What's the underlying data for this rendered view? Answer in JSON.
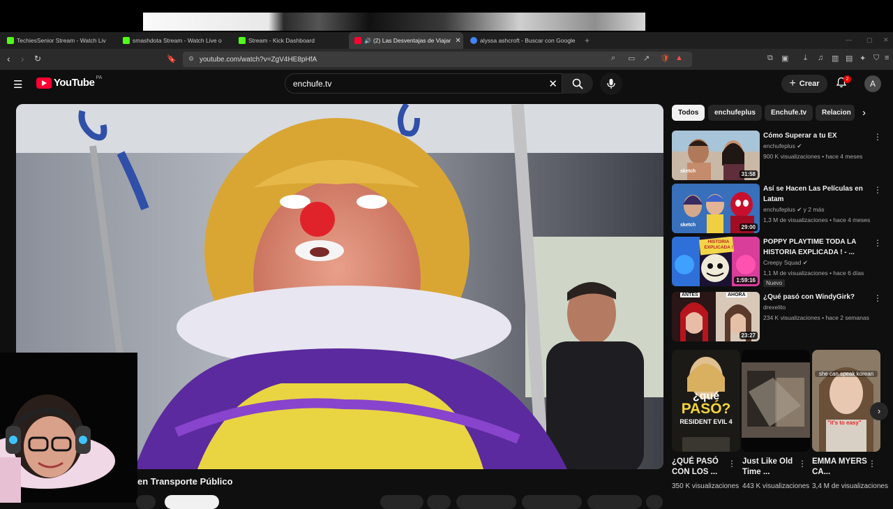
{
  "browser": {
    "tabs": [
      {
        "label": "TechiesSenior Stream - Watch Liv",
        "color": "#53fc18"
      },
      {
        "label": "smashdota Stream - Watch Live o",
        "color": "#53fc18"
      },
      {
        "label": "Stream - Kick Dashboard",
        "color": "#53fc18"
      },
      {
        "label": "(2) Las Desventajas de Viajar",
        "color": "#ff0033"
      },
      {
        "label": "alyssa ashcroft - Buscar con Google",
        "color": "#4285f4"
      }
    ],
    "url": "youtube.com/watch?v=ZgV4HE8pHfA"
  },
  "youtube": {
    "logo": "YouTube",
    "country": "PA",
    "search_value": "enchufe.tv",
    "create_label": "Crear",
    "notif_count": "2",
    "avatar_letter": "A"
  },
  "video": {
    "title": "en Transporte Público"
  },
  "chips": [
    "Todos",
    "enchufeplus",
    "Enchufe.tv",
    "Relacion"
  ],
  "recommendations": [
    {
      "title": "Cómo Superar a tu EX",
      "channel": "enchufeplus ✔",
      "meta": "900 K visualizaciones • hace 4 meses",
      "duration": "31:58",
      "tag": "sketch"
    },
    {
      "title": "Así se Hacen Las Películas en Latam",
      "channel": "enchufeplus ✔ y 2 más",
      "meta": "1,3 M de visualizaciones • hace 4 meses",
      "duration": "29:00",
      "tag": "sketch"
    },
    {
      "title": "POPPY PLAYTIME TODA LA HISTORIA EXPLICADA ! - ...",
      "channel": "Creepy Squad ✔",
      "meta": "1,1 M de visualizaciones • hace 6 días",
      "duration": "1:59:16",
      "badge": "Nuevo",
      "thumbtext": "HISTORIA EXPLICADA !"
    },
    {
      "title": "¿Qué pasó con WindyGirk?",
      "channel": "drexelito",
      "meta": "234 K visualizaciones • hace 2 semanas",
      "duration": "23:27",
      "before": "ANTES",
      "after": "AHORA"
    }
  ],
  "shorts": [
    {
      "title": "¿QUÉ PASÓ CON LOS ...",
      "views": "350 K visualizaciones",
      "art1": "¿qué",
      "art2": "PASÓ?",
      "art3": "RESIDENT EVIL 4"
    },
    {
      "title": "Just Like Old Time ...",
      "views": "443 K visualizaciones"
    },
    {
      "title": "EMMA MYERS CA...",
      "views": "3,4 M de visualizaciones",
      "art1": "she can speak korean",
      "art2": "\"it's to easy\""
    }
  ]
}
